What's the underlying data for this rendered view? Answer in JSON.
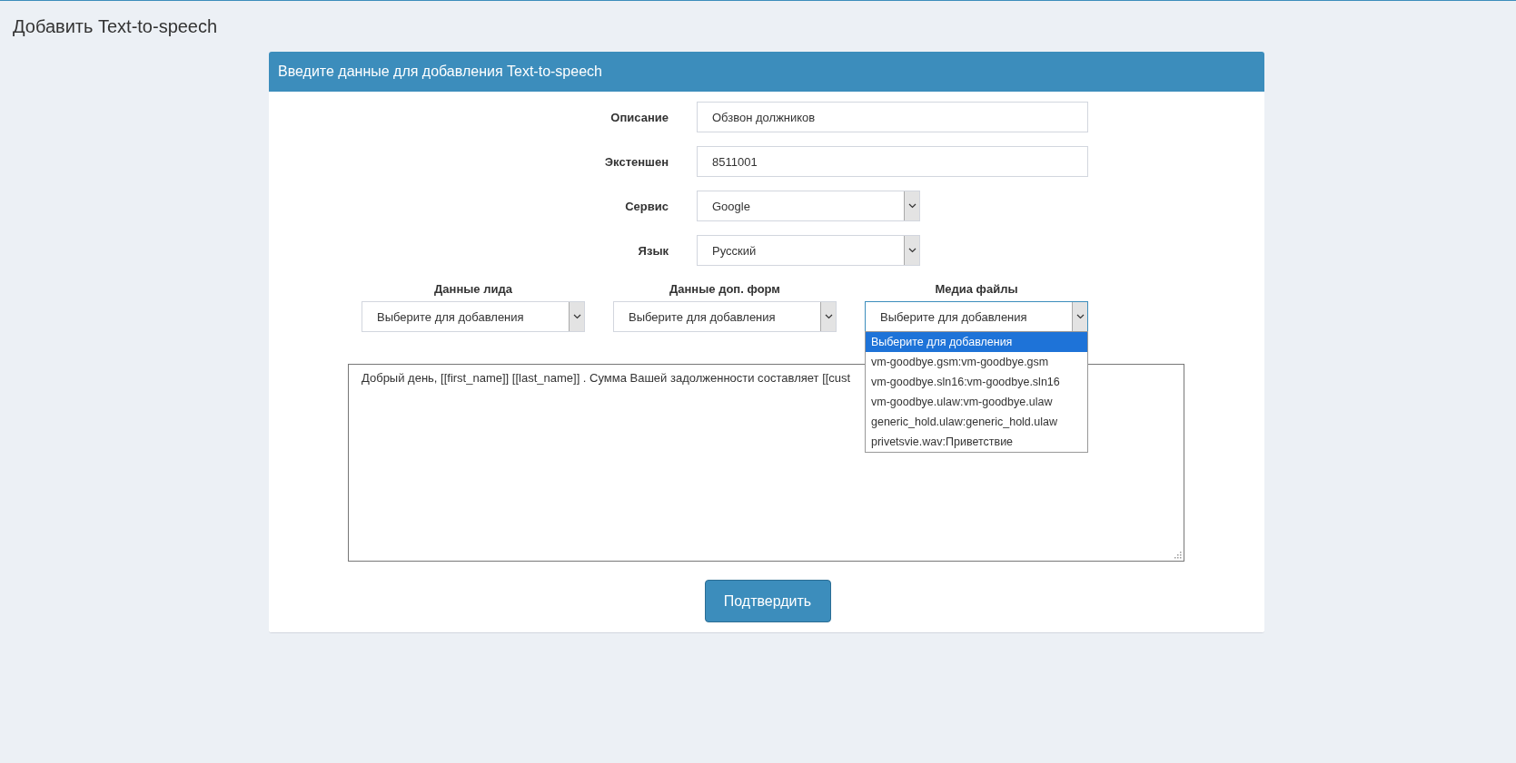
{
  "page_title": "Добавить Text-to-speech",
  "panel": {
    "heading": "Введите данные для добавления Text-to-speech",
    "fields": [
      {
        "kind": "text",
        "label": "Описание",
        "value": "Обзвон должников"
      },
      {
        "kind": "text",
        "label": "Экстеншен",
        "value": "8511001"
      },
      {
        "kind": "select",
        "label": "Сервис",
        "value": "Google"
      },
      {
        "kind": "select",
        "label": "Язык",
        "value": "Русский"
      }
    ],
    "inserters": [
      {
        "label": "Данные лида",
        "value": "Выберите для добавления",
        "open": false
      },
      {
        "label": "Данные доп. форм",
        "value": "Выберите для добавления",
        "open": false
      },
      {
        "label": "Медиа файлы",
        "value": "Выберите для добавления",
        "open": true,
        "options": [
          {
            "text": "Выберите для добавления",
            "selected": true
          },
          {
            "text": "vm-goodbye.gsm:vm-goodbye.gsm",
            "selected": false
          },
          {
            "text": "vm-goodbye.sln16:vm-goodbye.sln16",
            "selected": false
          },
          {
            "text": "vm-goodbye.ulaw:vm-goodbye.ulaw",
            "selected": false
          },
          {
            "text": "generic_hold.ulaw:generic_hold.ulaw",
            "selected": false
          },
          {
            "text": "privetsvie.wav:Приветствие",
            "selected": false
          }
        ]
      }
    ],
    "message": "Добрый день,  [[first_name]]  [[last_name]] . Сумма Вашей задолженности составляет  [[cust",
    "submit": "Подтвердить"
  }
}
